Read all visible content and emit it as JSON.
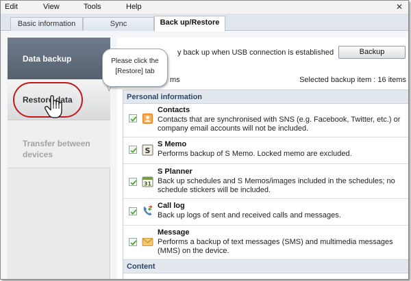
{
  "menu": {
    "items": [
      "Edit",
      "View",
      "Tools",
      "Help"
    ]
  },
  "tabs": [
    {
      "label": "Basic information",
      "active": false
    },
    {
      "label": "Sync",
      "active": false
    },
    {
      "label": "Back up/Restore",
      "active": true
    }
  ],
  "sidebar": {
    "items": [
      {
        "label": "Data backup"
      },
      {
        "label": "Restore data"
      },
      {
        "label": "Transfer between devices"
      }
    ]
  },
  "callout": {
    "line1": "Please click the",
    "line2": "[Restore] tab"
  },
  "main": {
    "auto_backup_text": "y back up when USB connection is established",
    "backup_button": "Backup",
    "items_label": "ms",
    "selected_count": "Selected backup item :  16 items",
    "sections": [
      {
        "header": "Personal information",
        "rows": [
          {
            "icon": "contacts-icon",
            "title": "Contacts",
            "desc": "Contacts that are synchronised with SNS (e.g. Facebook, Twitter, etc.) or company email accounts will not be included.",
            "checked": true
          },
          {
            "icon": "s-memo-icon",
            "title": "S Memo",
            "desc": "Performs backup of S Memo. Locked memo are excluded.",
            "checked": true
          },
          {
            "icon": "calendar-icon",
            "title": "S Planner",
            "desc": "Back up schedules and S Memos/images included in the schedules; no schedule stickers will be included.",
            "checked": true
          },
          {
            "icon": "call-log-icon",
            "title": "Call log",
            "desc": "Back up logs of sent and received calls and messages.",
            "checked": true
          },
          {
            "icon": "envelope-icon",
            "title": "Message",
            "desc": "Performs a backup of text messages (SMS) and multimedia messages (MMS) on the device.",
            "checked": true
          }
        ]
      },
      {
        "header": "Content"
      }
    ]
  },
  "colors": {
    "nav_active": "#5f6b7b",
    "highlight": "#c21818",
    "section_header_text": "#2d4566"
  }
}
